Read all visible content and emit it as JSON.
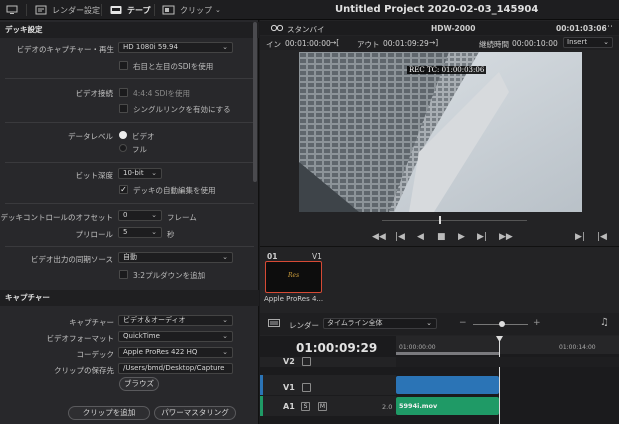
{
  "topbar": {
    "render_settings": "レンダー設定",
    "tape": "テープ",
    "clip": "クリップ",
    "title": "Untitled Project 2020-02-03_145904"
  },
  "deck": {
    "header": "デッキ設定",
    "video_capture_label": "ビデオのキャプチャー・再生",
    "video_capture_value": "HD 1080i 59.94",
    "sdi_lr_label": "右目と左目のSDIを使用",
    "video_connection_label": "ビデオ接続",
    "sdi444_label": "4:4:4 SDIを使用",
    "single_link_label": "シングルリンクを有効にする",
    "data_level_label": "データレベル",
    "data_level_video": "ビデオ",
    "data_level_full": "フル",
    "bit_depth_label": "ビット深度",
    "bit_depth_value": "10-bit",
    "auto_edit_label": "デッキの自動編集を使用",
    "offset_label": "デッキコントロールのオフセット",
    "offset_value": "0",
    "offset_unit": "フレーム",
    "preroll_label": "プリロール",
    "preroll_value": "5",
    "preroll_unit": "秒",
    "sync_label": "ビデオ出力の同期ソース",
    "sync_value": "自動",
    "pulldown_label": "3:2プルダウンを追加"
  },
  "capture": {
    "header": "キャプチャー",
    "capture_label": "キャプチャー",
    "capture_value": "ビデオ＆オーディオ",
    "format_label": "ビデオフォーマット",
    "format_value": "QuickTime",
    "codec_label": "コーデック",
    "codec_value": "Apple ProRes 422 HQ",
    "save_label": "クリップの保存先",
    "save_value": "/Users/bmd/Desktop/Capture",
    "browse": "ブラウズ",
    "add_clip": "クリップを追加",
    "power_mastering": "パワーマスタリング"
  },
  "viewer": {
    "standby": "スタンバイ",
    "tape_name": "HDW-2000",
    "timecode": "00:01:03:06",
    "in_label": "イン",
    "in_value": "00:01:00:00",
    "out_label": "アウト",
    "out_value": "00:01:09:29",
    "duration_label": "継続時間",
    "duration_value": "00:00:10:00",
    "mode": "Insert",
    "rec_tc": "REC TC: 01:00:03:06"
  },
  "bin": {
    "index": "01",
    "track": "V1",
    "clip_name": "Apple ProRes 4..."
  },
  "timeline": {
    "render_label": "レンダー",
    "render_value": "タイムライン全体",
    "timecode": "01:00:09:29",
    "ruler_start": "01:00:00:00",
    "ruler_end": "01:00:14:00",
    "tracks": [
      {
        "label": "V2"
      },
      {
        "label": "V1"
      },
      {
        "label": "A1",
        "level": "2.0",
        "clip": "5994i.mov",
        "s": "S",
        "m": "M"
      }
    ]
  },
  "colors": {
    "accent_red": "#d64a35",
    "video_clip": "#2b74b6",
    "audio_clip": "#1f9a66"
  }
}
